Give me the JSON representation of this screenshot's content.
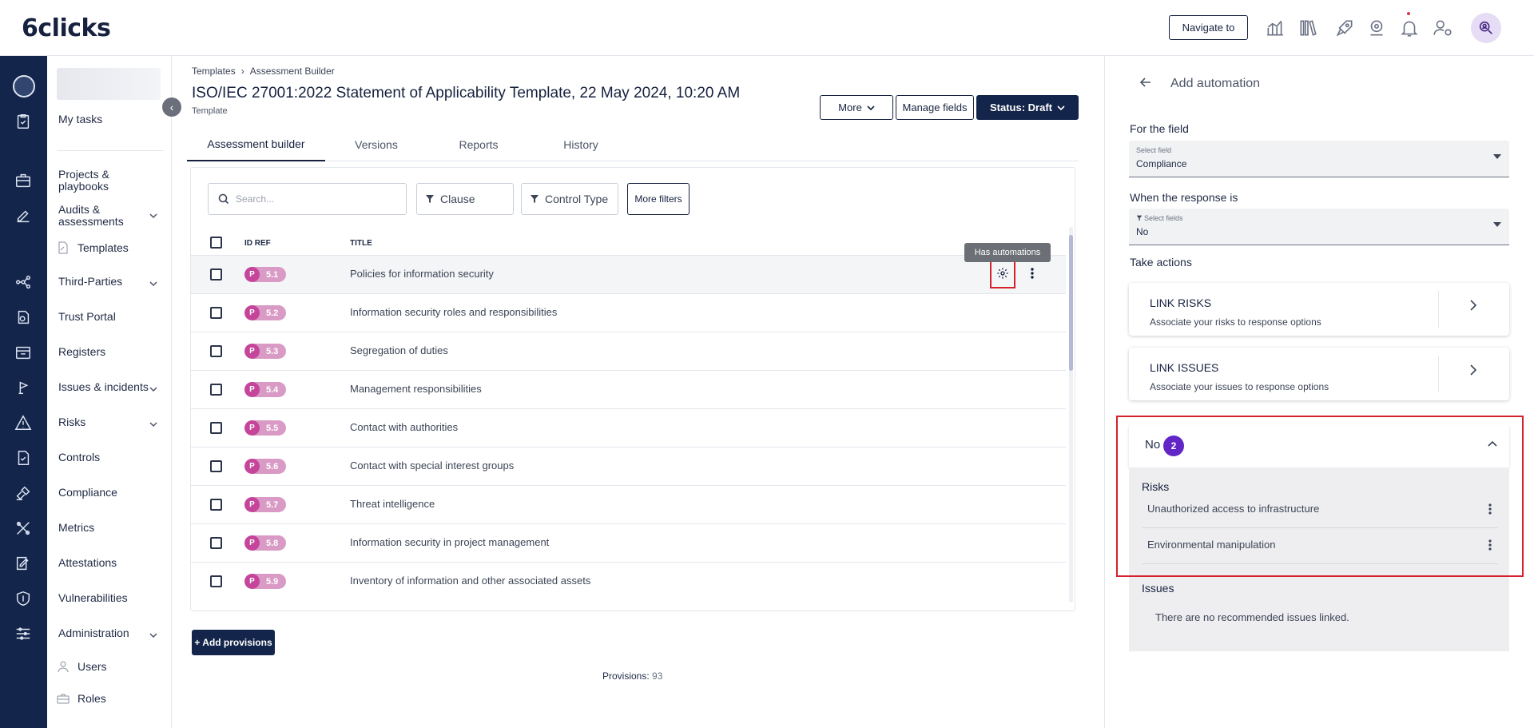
{
  "brand": {
    "logo_text": "6clicks"
  },
  "header": {
    "navigate_label": "Navigate to",
    "icons": [
      "analytics-icon",
      "library-icon",
      "rocket-icon",
      "support-icon",
      "bell-icon",
      "user-settings-icon",
      "global-search-icon"
    ]
  },
  "rail": {
    "icons": [
      "home-icon",
      "tasks-icon",
      "projects-icon",
      "audits-icon",
      "third-parties-icon",
      "trust-portal-icon",
      "registers-icon",
      "issues-icon",
      "risks-icon",
      "controls-icon",
      "compliance-icon",
      "metrics-icon",
      "attestations-icon",
      "vulnerabilities-icon",
      "administration-icon"
    ]
  },
  "sidenav": {
    "my_tasks": "My tasks",
    "projects": "Projects & playbooks",
    "audits": "Audits & assessments",
    "templates": "Templates",
    "third_parties": "Third-Parties",
    "trust_portal": "Trust Portal",
    "registers": "Registers",
    "issues": "Issues & incidents",
    "risks": "Risks",
    "controls": "Controls",
    "compliance": "Compliance",
    "metrics": "Metrics",
    "attestations": "Attestations",
    "vulnerabilities": "Vulnerabilities",
    "administration": "Administration",
    "users": "Users",
    "roles": "Roles"
  },
  "breadcrumb": {
    "root": "Templates",
    "current": "Assessment Builder"
  },
  "page": {
    "title": "ISO/IEC 27001:2022 Statement of Applicability Template, 22 May 2024, 10:20 AM",
    "subtitle": "Template",
    "more_label": "More",
    "manage_fields_label": "Manage fields",
    "status_label": "Status: Draft"
  },
  "tabs": [
    "Assessment builder",
    "Versions",
    "Reports",
    "History"
  ],
  "filters": {
    "search_placeholder": "Search...",
    "clause_label": "Clause",
    "control_type_label": "Control Type",
    "more_filters_label": "More filters"
  },
  "table": {
    "col_id": "ID REF",
    "col_title": "TITLE",
    "badge_prefix": "P",
    "rows": [
      {
        "id": "5.1",
        "title": "Policies for information security"
      },
      {
        "id": "5.2",
        "title": "Information security roles and responsibilities"
      },
      {
        "id": "5.3",
        "title": "Segregation of duties"
      },
      {
        "id": "5.4",
        "title": "Management responsibilities"
      },
      {
        "id": "5.5",
        "title": "Contact with authorities"
      },
      {
        "id": "5.6",
        "title": "Contact with special interest groups"
      },
      {
        "id": "5.7",
        "title": "Threat intelligence"
      },
      {
        "id": "5.8",
        "title": "Information security in project management"
      },
      {
        "id": "5.9",
        "title": "Inventory of information and other associated assets"
      }
    ],
    "tooltip": "Has automations"
  },
  "footer": {
    "add_label": "+ Add provisions",
    "provisions_label": "Provisions:",
    "provisions_count": "93"
  },
  "automation": {
    "title": "Add automation",
    "for_field_label": "For the field",
    "field_caption": "Select field",
    "field_value": "Compliance",
    "response_label": "When the response is",
    "response_caption": "Select fields",
    "response_value": "No",
    "take_actions_label": "Take actions",
    "actions": [
      {
        "title": "LINK RISKS",
        "desc": "Associate your risks to response options"
      },
      {
        "title": "LINK ISSUES",
        "desc": "Associate your issues to response options"
      }
    ],
    "group": {
      "label": "No",
      "count": "2",
      "risks_title": "Risks",
      "risks": [
        "Unauthorized access to infrastructure",
        "Environmental manipulation"
      ],
      "issues_title": "Issues",
      "issues_empty": "There are no recommended issues linked."
    }
  },
  "colors": {
    "brand_navy": "#13254a",
    "badge_pink": "#c4459a",
    "count_purple": "#6226c7",
    "highlight_red": "#d6202c"
  }
}
